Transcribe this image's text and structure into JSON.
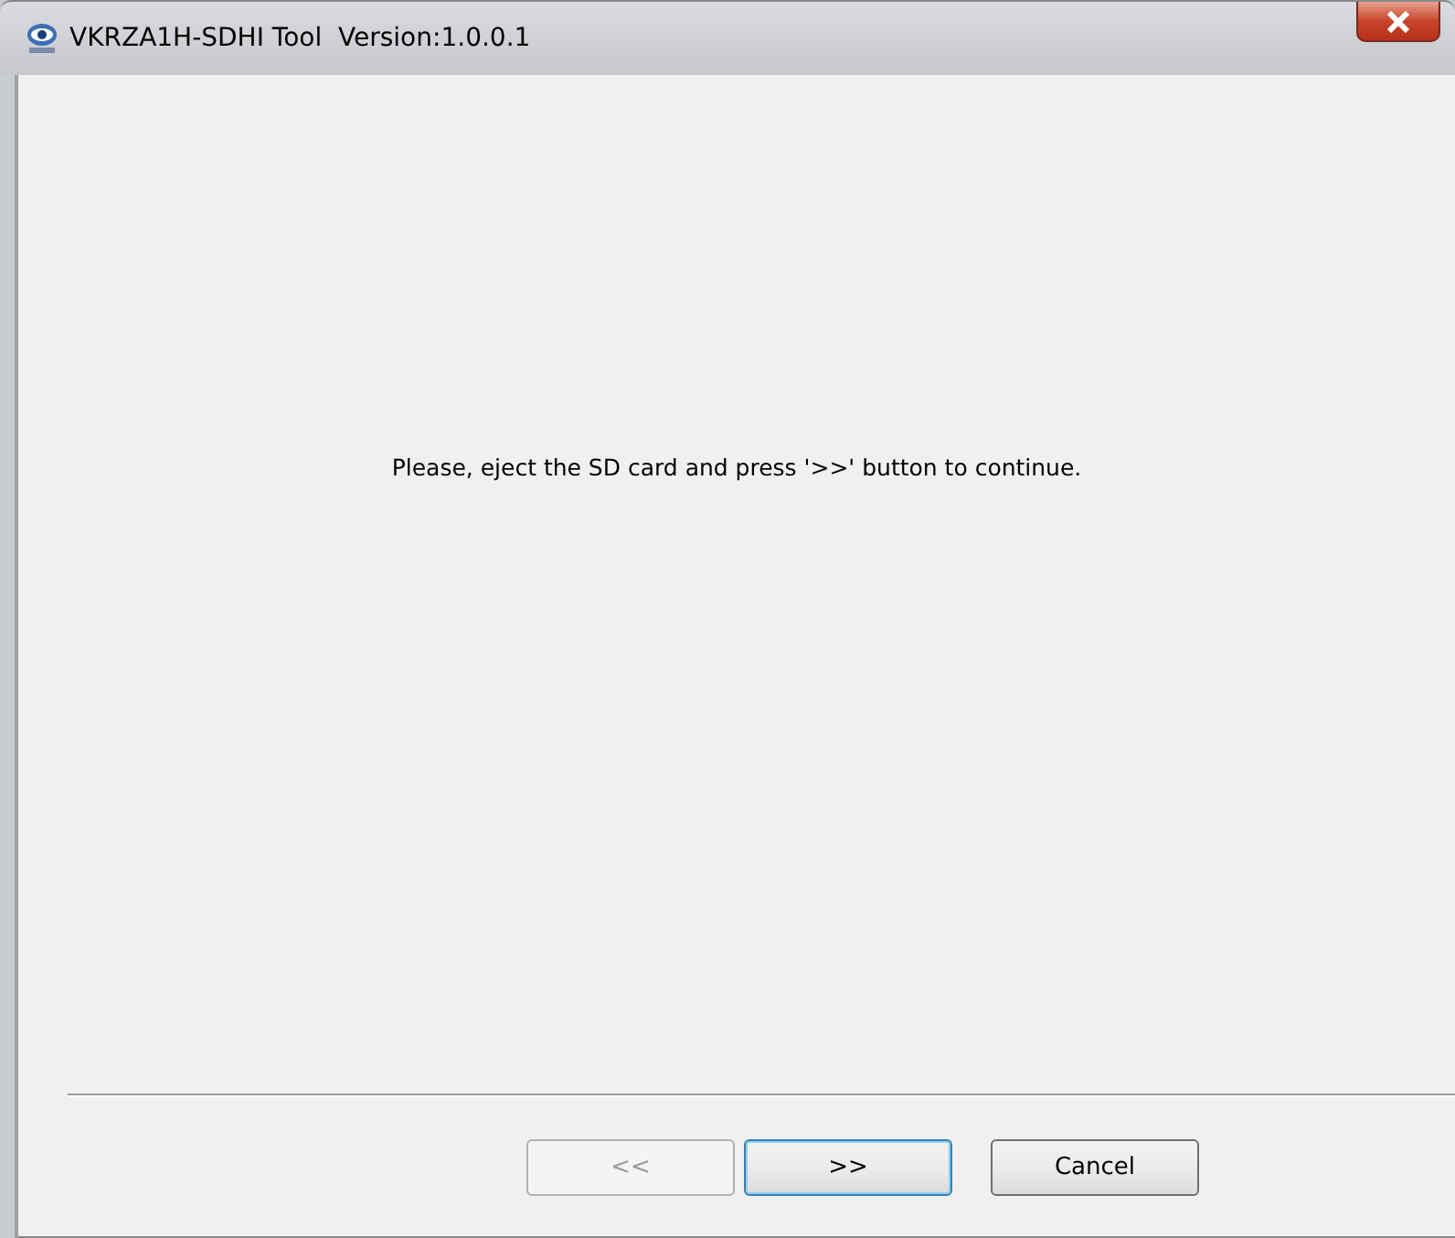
{
  "window": {
    "title": "VKRZA1H-SDHI Tool  Version:1.0.0.1"
  },
  "message": "Please, eject the SD card and press '>>' button to continue.",
  "buttons": [
    {
      "label": "<<",
      "disabled": true,
      "default": false
    },
    {
      "label": ">>",
      "disabled": false,
      "default": true
    },
    {
      "label": "Cancel",
      "disabled": false,
      "default": false
    }
  ]
}
